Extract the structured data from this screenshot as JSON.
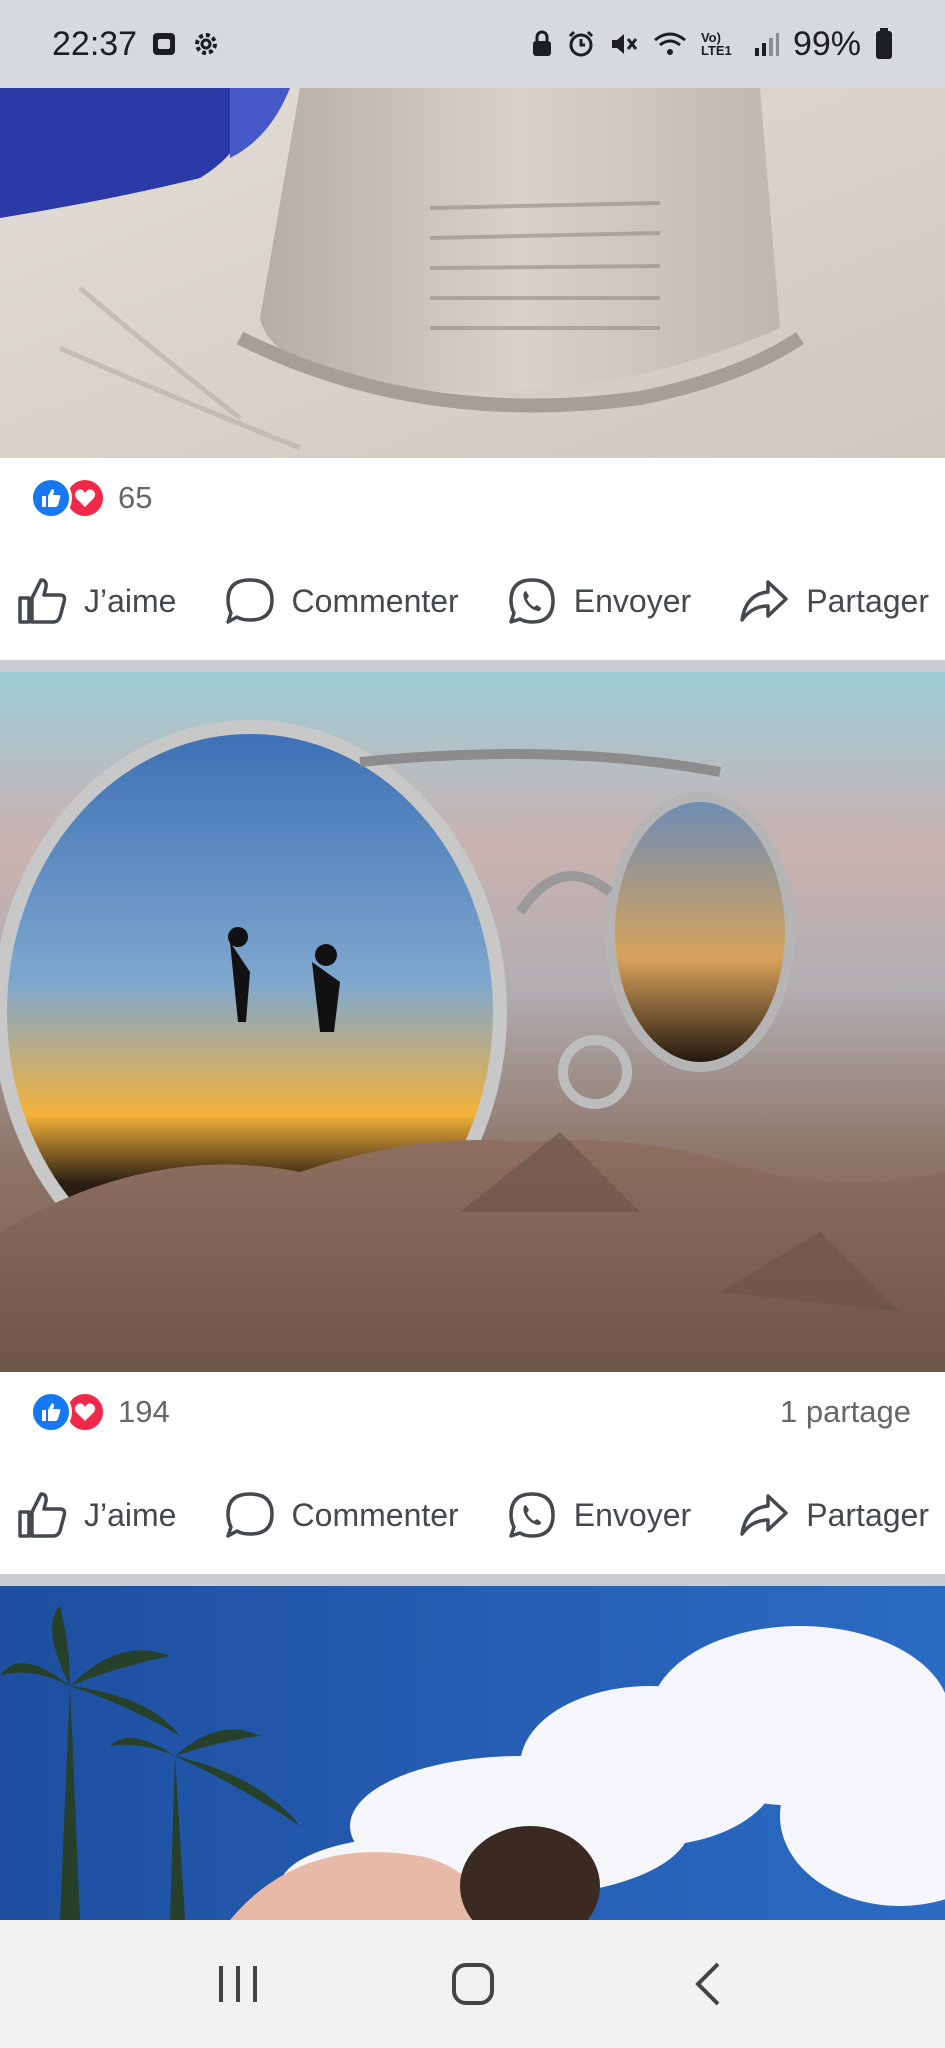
{
  "status_bar": {
    "time": "22:37",
    "battery": "99%",
    "network_label": "Vo) LTE1",
    "icons": [
      "screenshot-icon",
      "settings-icon",
      "lock-icon",
      "alarm-icon",
      "mute-icon",
      "wifi-icon",
      "signal-icon",
      "battery-icon"
    ]
  },
  "posts": [
    {
      "photo": "sand-castle-photo",
      "reaction_count": "65",
      "share_text": "",
      "actions": {
        "like": "J’aime",
        "comment": "Commenter",
        "send": "Envoyer",
        "share": "Partager"
      }
    },
    {
      "photo": "sunglasses-sand-photo",
      "reaction_count": "194",
      "share_text": "1 partage",
      "actions": {
        "like": "J’aime",
        "comment": "Commenter",
        "send": "Envoyer",
        "share": "Partager"
      }
    },
    {
      "photo": "palm-beach-photo"
    }
  ],
  "nav_bar": {
    "buttons": [
      "recent-apps-icon",
      "home-icon",
      "back-icon"
    ]
  },
  "colors": {
    "like": "#1877f2",
    "love": "#f02849",
    "divider": "#c9ccd1",
    "statusbar": "#d6d9dd"
  }
}
